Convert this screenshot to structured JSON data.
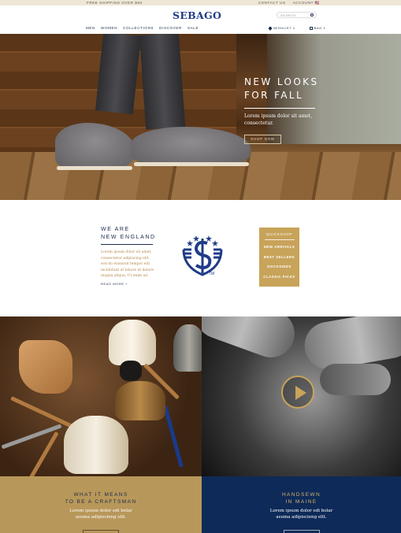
{
  "utility": {
    "shipping": "FREE SHIPPING OVER $60",
    "contact": "CONTACT US",
    "account": "ACCOUNT",
    "flag": "🇺🇸"
  },
  "header": {
    "logo": "SEBAGO",
    "search_placeholder": "SEARCH",
    "nav": [
      "MEN",
      "WOMEN",
      "COLLECTIONS",
      "DISCOVER",
      "SALE"
    ],
    "wishlist": "WISHLIST",
    "wishlist_count": "1",
    "bag": "BAG",
    "bag_count": "1"
  },
  "hero": {
    "title_line1": "NEW LOOKS",
    "title_line2": "FOR FALL",
    "text": "Lorem ipsum dolor sit amet, consectetur.",
    "button": "SHOP NOW"
  },
  "new_england": {
    "title_line1": "WE ARE",
    "title_line2": "NEW ENGLAND",
    "text": "Lorem ipsum dolor sit amet, consectetur adipiscing elit, sed do eiusmod tempor elit incididunt ut labore et dolore magna aliqua. Ut enim ad.",
    "read_more": "READ MORE +"
  },
  "quickshop": {
    "heading": "QUICKSHOP",
    "items": [
      "NEW ARRIVALS",
      "BEST SELLERS",
      "DOCKSIDES",
      "CLASSIC PICKS"
    ]
  },
  "panels": [
    {
      "title_line1": "WHAT IT MEANS",
      "title_line2": "TO BE A CRAFTSMAN",
      "text_line1": "Lorem ipsum dolor edi bolar",
      "text_line2": "asuma adipiscieng elit."
    },
    {
      "title_line1": "HANDSEWN",
      "title_line2": "IN MAINE",
      "text_line1": "Lorem ipsum dolor edi bolar",
      "text_line2": "asuma adipiscieng elit."
    }
  ],
  "colors": {
    "navy": "#0e2a58",
    "gold": "#c8a35a",
    "logo_blue": "#1f3c88"
  }
}
